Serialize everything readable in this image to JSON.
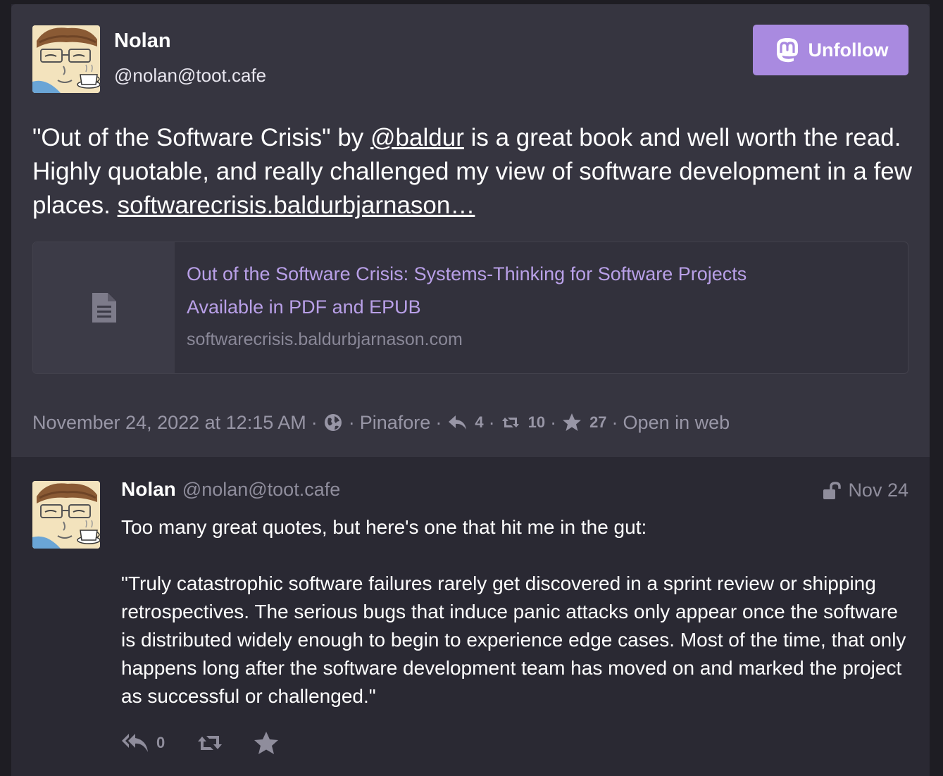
{
  "colors": {
    "page_bg": "#1e1d23",
    "main_status_bg": "#363540",
    "reply_status_bg": "#2a2933",
    "accent": "#a98ae0",
    "link_card_text": "#b9a0e8",
    "muted_text": "#9896a6"
  },
  "main_status": {
    "author_name": "Nolan",
    "author_handle": "@nolan@toot.cafe",
    "avatar_icon": "avatar-coffee-cup",
    "unfollow_button": {
      "label": "Unfollow",
      "icon": "mastodon-logo-icon"
    },
    "content": {
      "part1": "\"Out of the Software Crisis\" by ",
      "mention": "@baldur",
      "part2": " is a great book and well worth the read. Highly quotable, and really challenged my view of software development in a few places. ",
      "link": "softwarecrisis.baldurbjarnason…"
    },
    "card": {
      "icon": "document-icon",
      "title": "Out of the Software Crisis: Systems-Thinking for Software Projects",
      "description": "Available in PDF and EPUB",
      "domain": "softwarecrisis.baldurbjarnason.com"
    },
    "meta": {
      "date": "November 24, 2022 at 12:15 AM",
      "visibility_icon": "globe-icon",
      "application": "Pinafore",
      "replies": "4",
      "boosts": "10",
      "favorites": "27",
      "open_in_web": "Open in web"
    }
  },
  "reply_status": {
    "author_name": "Nolan",
    "author_handle": "@nolan@toot.cafe",
    "visibility_icon": "unlock-icon",
    "date": "Nov 24",
    "paragraphs": [
      "Too many great quotes, but here's one that hit me in the gut:",
      "\"Truly catastrophic software failures rarely get discovered in a sprint review or shipping retrospectives. The serious bugs that induce panic attacks only appear once the software is distributed widely enough to begin to experience edge cases. Most of the time, that only happens long after the software development team has moved on and marked the project as successful or challenged.\""
    ],
    "actions": {
      "reply_count": "0",
      "reply_icon": "reply-all-icon",
      "boost_icon": "retweet-icon",
      "favorite_icon": "star-icon"
    }
  }
}
